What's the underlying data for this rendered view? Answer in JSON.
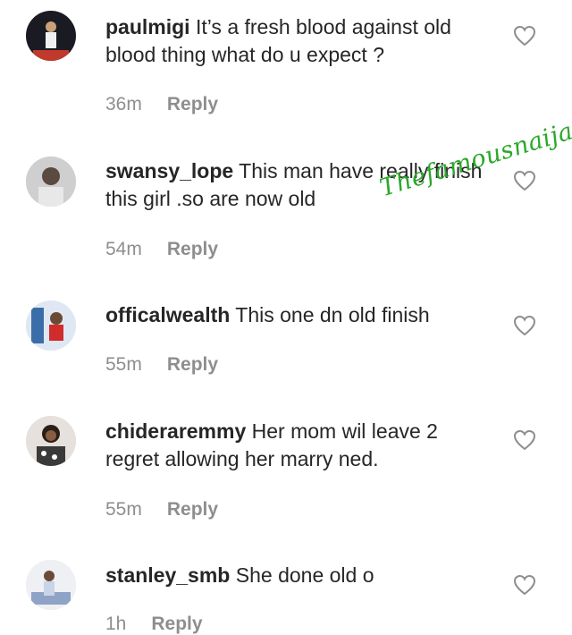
{
  "comments": [
    {
      "username": "paulmigi",
      "text": " It’s a fresh blood against old blood thing what do u expect ?",
      "time": "36m",
      "reply": "Reply"
    },
    {
      "username": "swansy_lope",
      "text": " This man have really finish this girl .so are now old",
      "time": "54m",
      "reply": "Reply"
    },
    {
      "username": "officalwealth",
      "text": " This one dn old finish",
      "time": "55m",
      "reply": "Reply"
    },
    {
      "username": "chideraremmy",
      "text": " Her mom wil leave 2 regret allowing her marry ned.",
      "time": "55m",
      "reply": "Reply"
    },
    {
      "username": "stanley_smb",
      "text": " She done old o",
      "time": "1h",
      "reply": "Reply"
    }
  ],
  "watermark": "Thefamousnaija",
  "icons": {
    "like": "heart-outline-icon"
  }
}
